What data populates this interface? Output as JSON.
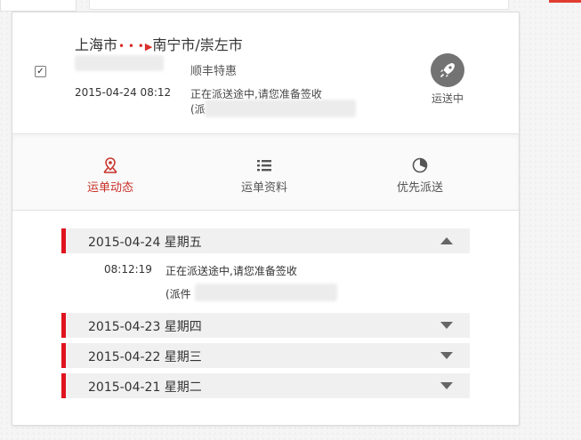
{
  "summary": {
    "selected": true,
    "route": {
      "from": "上海市",
      "to": "南宁市/崇左市"
    },
    "date": "2015-04-24 08:12",
    "carrier": "顺丰特惠",
    "status_text": "正在派送途中,请您准备签收",
    "status_text_2": "(派",
    "status_label": "运送中",
    "status_icon": "rocket-icon"
  },
  "tabs": [
    {
      "label": "运单动态",
      "icon": "map-pin-icon",
      "active": true
    },
    {
      "label": "运单资料",
      "icon": "list-icon",
      "active": false
    },
    {
      "label": "优先派送",
      "icon": "pie-icon",
      "active": false
    }
  ],
  "timeline": [
    {
      "date": "2015-04-24 星期五",
      "expanded": true,
      "entries": [
        {
          "time": "08:12:19",
          "text": "正在派送途中,请您准备签收",
          "text_2": "(派件"
        }
      ]
    },
    {
      "date": "2015-04-23 星期四",
      "expanded": false
    },
    {
      "date": "2015-04-22 星期三",
      "expanded": false
    },
    {
      "date": "2015-04-21 星期二",
      "expanded": false
    }
  ],
  "colors": {
    "accent_red": "#e0141e",
    "active_tab": "#c8312a",
    "badge_gray": "#737373"
  }
}
